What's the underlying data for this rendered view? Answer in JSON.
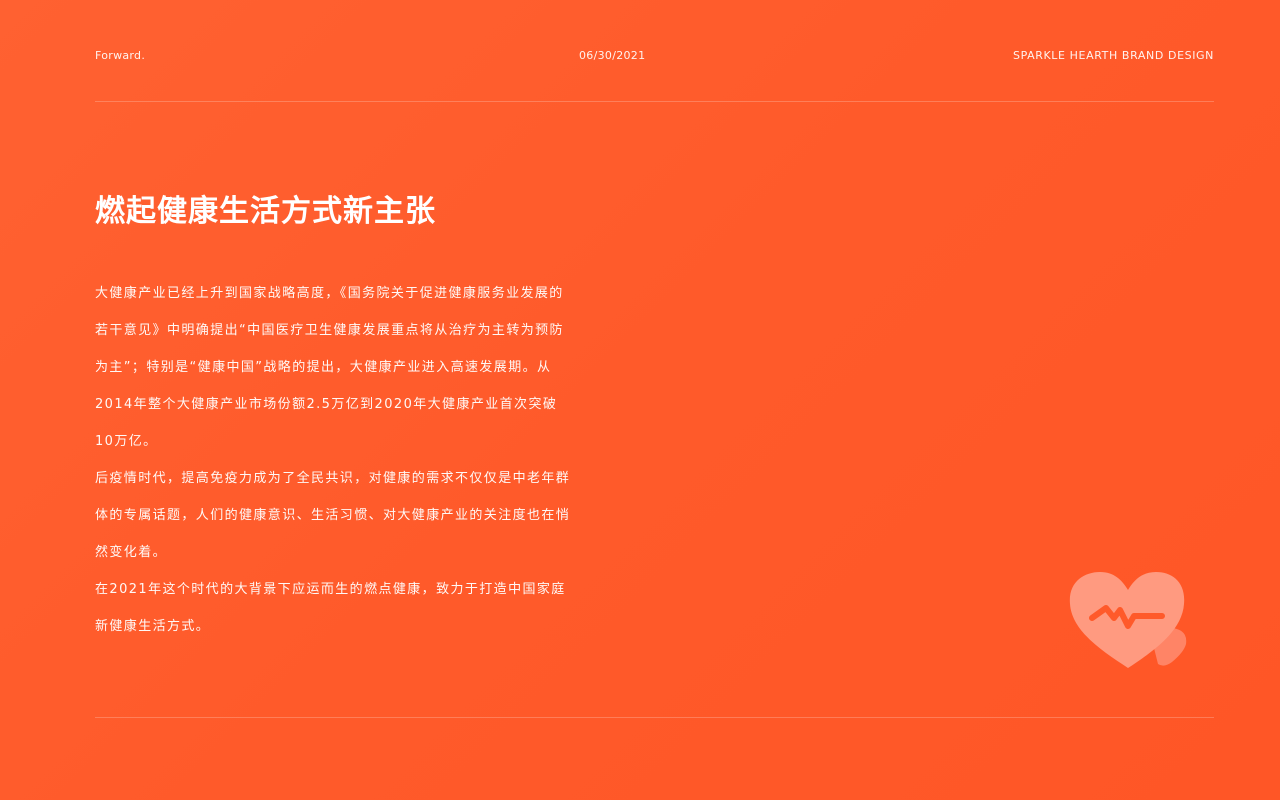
{
  "header": {
    "left": "Forward.",
    "center": "06/30/2021",
    "right": "SPARKLE HEARTH BRAND DESIGN"
  },
  "title": "燃起健康生活方式新主张",
  "paragraphs": [
    "大健康产业已经上升到国家战略高度，《国务院关于促进健康服务业发展的若干意见》中明确提出“中国医疗卫生健康发展重点将从治疗为主转为预防为主”；特别是“健康中国”战略的提出，大健康产业进入高速发展期。从2014年整个大健康产业市场份额2.5万亿到2020年大健康产业首次突破10万亿。",
    "后疫情时代，提高免疫力成为了全民共识，对健康的需求不仅仅是中老年群体的专属话题，人们的健康意识、生活习惯、对大健康产业的关注度也在悄然变化着。",
    "在2021年这个时代的大背景下应运而生的燃点健康，致力于打造中国家庭新健康生活方式。"
  ],
  "logo": {
    "icon": "heart-pulse-icon",
    "heart_color": "#ff9a80",
    "pulse_color": "#ff5a2a"
  },
  "colors": {
    "background": "#ff5a2a",
    "text": "#ffffff"
  }
}
